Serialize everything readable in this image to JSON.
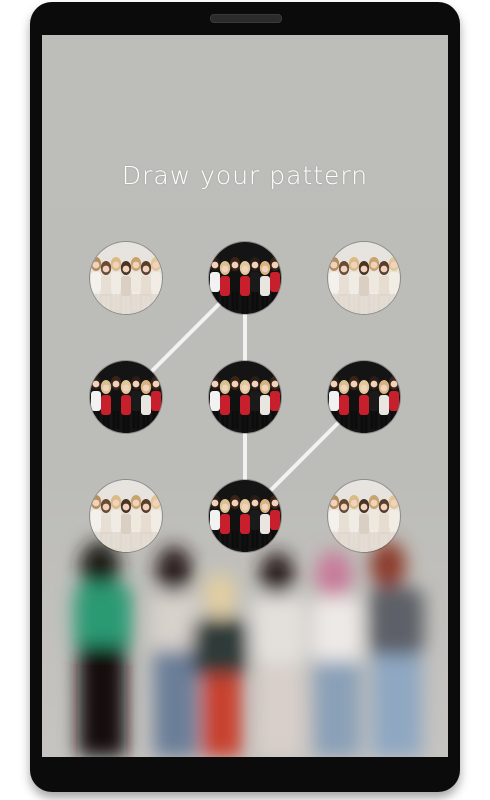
{
  "screen": {
    "title": "Draw your pattern"
  },
  "pattern": {
    "grid": [
      "1",
      "2",
      "3",
      "4",
      "5",
      "6",
      "7",
      "8",
      "9"
    ],
    "selected_sequence": [
      "4",
      "2",
      "5",
      "8",
      "6"
    ],
    "line_color": "#f2f2f2"
  },
  "dots": [
    {
      "id": "1",
      "photo": "light-group-photo",
      "selected": false
    },
    {
      "id": "2",
      "photo": "dark-group-photo",
      "selected": true
    },
    {
      "id": "3",
      "photo": "light-group-photo",
      "selected": false
    },
    {
      "id": "4",
      "photo": "dark-group-photo",
      "selected": true
    },
    {
      "id": "5",
      "photo": "dark-group-photo",
      "selected": true
    },
    {
      "id": "6",
      "photo": "dark-group-photo",
      "selected": true
    },
    {
      "id": "7",
      "photo": "light-group-photo",
      "selected": false
    },
    {
      "id": "8",
      "photo": "dark-group-photo",
      "selected": true
    },
    {
      "id": "9",
      "photo": "light-group-photo",
      "selected": false
    }
  ],
  "colors": {
    "background": "#bcbcb8",
    "frame": "#0b0b0b",
    "text": "#ffffff"
  }
}
